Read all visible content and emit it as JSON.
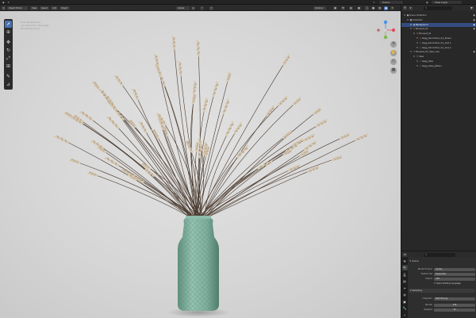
{
  "topbar": {
    "scene": "Scene",
    "view_layer": "View Layer"
  },
  "viewport_header": {
    "mode": "Object Mode",
    "menus": [
      "View",
      "Select",
      "Add",
      "Object"
    ],
    "orientation": "Global",
    "options": "Options"
  },
  "viewport": {
    "overlay_lines": [
      "User Perspective",
      "(1) Collection | Bouquet",
      "Rendering Done"
    ]
  },
  "outliner": {
    "header_icon": "filter-icon",
    "rows": [
      {
        "label": "Scene Collection",
        "indent": 0,
        "icon": "▣",
        "selected": false
      },
      {
        "label": "Collection",
        "indent": 1,
        "icon": "▣",
        "selected": false
      },
      {
        "label": "Background",
        "indent": 2,
        "icon": "◆",
        "selected": true
      },
      {
        "label": "Bouquet_01",
        "indent": 2,
        "icon": "▽",
        "selected": false
      },
      {
        "label": "Bouquet_01",
        "indent": 3,
        "icon": "▽",
        "selected": false
      },
      {
        "label": "Sagg_Decorative_dry_flower",
        "indent": 4,
        "icon": "◇",
        "selected": false
      },
      {
        "label": "Sagg_Decorative_dry_leaf_1",
        "indent": 4,
        "icon": "◇",
        "selected": false
      },
      {
        "label": "Sagg_Decorative_dry_leaf_2",
        "indent": 4,
        "icon": "◇",
        "selected": false
      },
      {
        "label": "Bouquet_01_Vase_rose",
        "indent": 2,
        "icon": "▽",
        "selected": false
      },
      {
        "label": "Vase",
        "indent": 3,
        "icon": "▽",
        "selected": false
      },
      {
        "label": "Sagg_Vase",
        "indent": 4,
        "icon": "◇",
        "selected": false
      },
      {
        "label": "Sagg_Vase_pattern",
        "indent": 4,
        "icon": "◇",
        "selected": false
      }
    ]
  },
  "properties": {
    "section": "Scene",
    "render_engine_label": "Render Engine",
    "render_engine": "Cycles",
    "feature_set_label": "Feature Set",
    "feature_set": "Supported",
    "device_label": "Device",
    "device": "CPU",
    "osl_label": "Open Shading Language",
    "sampling_panel": "Sampling",
    "integrator_label": "Integrator",
    "integrator": "Path Tracing",
    "render_label": "Render",
    "render_value": "128",
    "viewport_label": "Viewport",
    "viewport_value": "32"
  },
  "colors": {
    "accent": "#4772b3",
    "vase": "#7fae9c",
    "background": "#d6d6d6"
  }
}
